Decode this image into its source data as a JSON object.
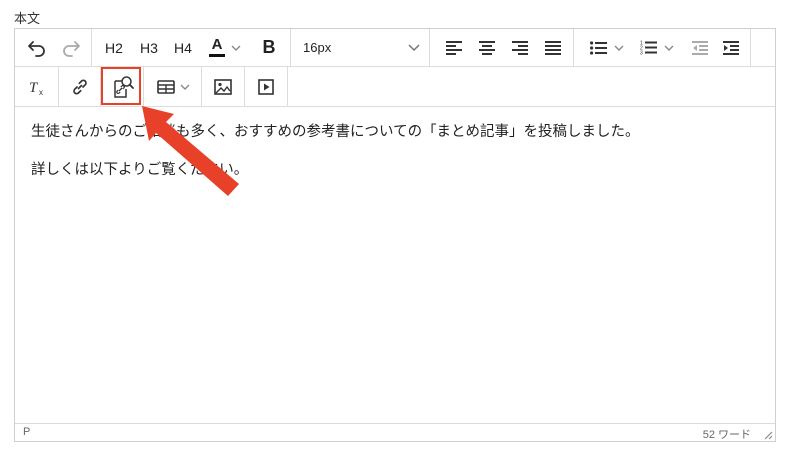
{
  "field": {
    "label": "本文"
  },
  "toolbar": {
    "undo_icon": "undo-icon",
    "redo_icon": "redo-icon",
    "h2": "H2",
    "h3": "H3",
    "h4": "H4",
    "text_color_letter": "A",
    "bold": "B",
    "font_size": "16px",
    "align_icons": [
      "align-left-icon",
      "align-center-icon",
      "align-right-icon",
      "align-justify-icon"
    ],
    "list_icons": [
      "bullet-list-icon",
      "numbered-list-icon",
      "outdent-icon",
      "indent-icon"
    ],
    "row2_icons": [
      "clear-format-icon",
      "link-icon",
      "internal-link-search-icon",
      "table-icon",
      "image-icon",
      "media-icon"
    ]
  },
  "content": {
    "paragraphs": [
      "生徒さんからのご相談も多く、おすすめの参考書についての「まとめ記事」を投稿しました。",
      "詳しくは以下よりご覧ください。"
    ]
  },
  "status": {
    "path": "P",
    "word_count": "52 ワード"
  },
  "colors": {
    "highlight": "#e8412a",
    "text_color_underline": "#111111"
  }
}
